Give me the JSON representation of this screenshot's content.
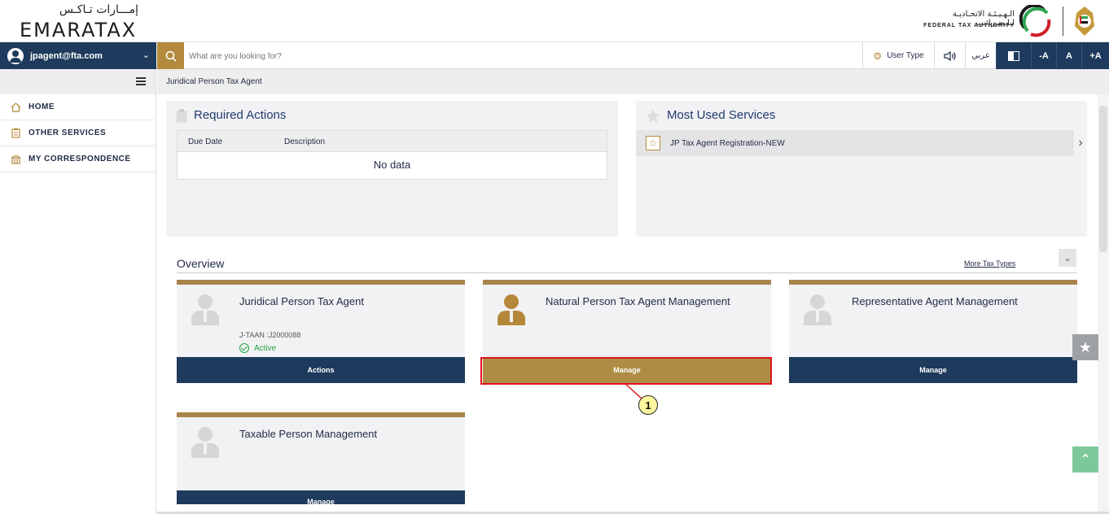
{
  "header": {
    "logo_ar": "إمـــارات تـاكـس",
    "logo_en": "EMARATAX",
    "fta_ar": "الـهـيـئـة الاتحـاديـة لـلـضـرائـب",
    "fta_en": "FEDERAL TAX AUTHORITY"
  },
  "navbar": {
    "user_email": "jpagent@fta.com",
    "search_placeholder": "What are you looking for?",
    "user_type_label": "User Type",
    "arabic_label": "عربي",
    "font_decrease": "-A",
    "font_normal": "A",
    "font_increase": "+A"
  },
  "sidebar": {
    "items": [
      {
        "label": "HOME",
        "icon": "home-icon"
      },
      {
        "label": "OTHER SERVICES",
        "icon": "clipboard-icon"
      },
      {
        "label": "MY CORRESPONDENCE",
        "icon": "building-icon"
      }
    ]
  },
  "breadcrumb": "Juridical Person Tax Agent",
  "required_actions": {
    "title": "Required Actions",
    "columns": [
      "Due Date",
      "Description"
    ],
    "empty_text": "No data"
  },
  "most_used": {
    "title": "Most Used Services",
    "items": [
      "JP Tax Agent Registration-NEW"
    ]
  },
  "overview": {
    "title": "Overview",
    "more_link": "More Tax Types",
    "cards": [
      {
        "title": "Juridical Person Tax Agent",
        "tan": "J-TAAN :J2000088",
        "status": "Active",
        "button": "Actions"
      },
      {
        "title": "Natural Person Tax Agent Management",
        "button": "Manage"
      },
      {
        "title": "Representative Agent Management",
        "button": "Manage"
      },
      {
        "title": "Taxable Person Management",
        "button": "Manage"
      }
    ]
  },
  "annotation": {
    "callout": "1"
  },
  "colors": {
    "navy": "#1e3a5c",
    "gold": "#ae8c43",
    "highlight": "#e0141e",
    "active_green": "#22a045"
  }
}
